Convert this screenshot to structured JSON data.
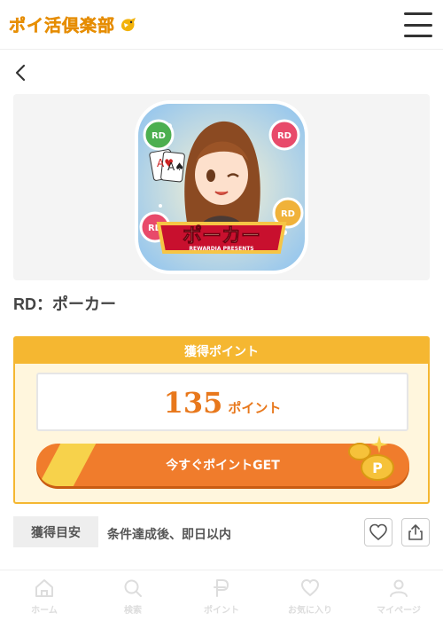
{
  "header": {
    "logo_text": "ポイ活倶楽部",
    "logo_icon": "bird-icon",
    "menu_icon": "hamburger-menu-icon"
  },
  "nav": {
    "back_icon": "chevron-left-icon"
  },
  "offer": {
    "app_icon_text": "ポーカー",
    "app_icon_subtext": "REWARDIA PRESENTS",
    "chip_label": "RD",
    "title": "RD：ポーカー"
  },
  "points": {
    "header": "獲得ポイント",
    "value": "135",
    "unit": "ポイント",
    "button_label": "今すぐポイントGET",
    "coin_label": "P"
  },
  "meta": {
    "tag": "獲得目安",
    "text": "条件達成後、即日以内",
    "favorite_icon": "heart-icon",
    "share_icon": "share-icon"
  },
  "tabbar": {
    "items": [
      {
        "label": "ホーム",
        "icon": "home-icon"
      },
      {
        "label": "検索",
        "icon": "search-icon"
      },
      {
        "label": "ポイント",
        "icon": "point-icon"
      },
      {
        "label": "お気に入り",
        "icon": "heart-icon"
      },
      {
        "label": "マイページ",
        "icon": "user-icon"
      }
    ]
  },
  "colors": {
    "accent": "#f5b731",
    "button": "#f07c2c",
    "point_text": "#e8781c",
    "logo": "#f2a20a"
  }
}
